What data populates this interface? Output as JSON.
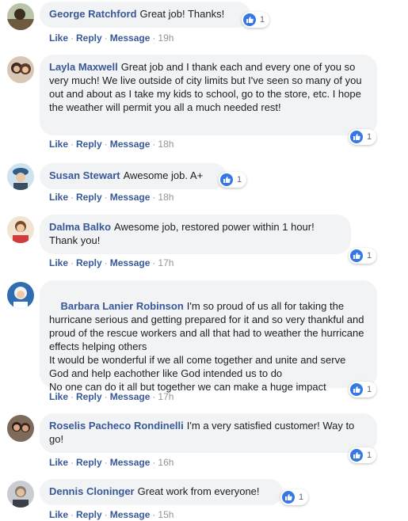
{
  "comments": [
    {
      "author": "George Ratchford",
      "text": "Great job! Thanks!",
      "reactions": "1",
      "actions": {
        "like": "Like",
        "reply": "Reply",
        "message": "Message",
        "time": "19h"
      }
    },
    {
      "author": "Layla Maxwell",
      "text": "Great job and I thank each and every one of you so very much! We live outside of city limits but I've seen so many of you out and about as I take my kids to school, go to the store, etc. I hope the weather will permit you all a much needed rest!",
      "reactions": "1",
      "actions": {
        "like": "Like",
        "reply": "Reply",
        "message": "Message",
        "time": "18h"
      }
    },
    {
      "author": "Susan Stewart",
      "text": "Awesome job. A+",
      "reactions": "1",
      "actions": {
        "like": "Like",
        "reply": "Reply",
        "message": "Message",
        "time": "18h"
      }
    },
    {
      "author": "Dalma Balko",
      "text": "Awesome job, restored power within 1 hour! Thank you!",
      "reactions": "1",
      "actions": {
        "like": "Like",
        "reply": "Reply",
        "message": "Message",
        "time": "17h"
      }
    },
    {
      "author": "Barbara Lanier Robinson",
      "text": "I'm so proud of us all for taking the hurricane serious and getting prepared for it and so very thankful and proud of the rescue workers and all that had to weather the hurricane effects helping others\nIt would be wonderful if we all come together and unite and serve God and help eachother like God intended us to do\nNo one can do it all but together we can make a huge impact",
      "reactions": "1",
      "actions": {
        "like": "Like",
        "reply": "Reply",
        "message": "Message",
        "time": "17h"
      }
    },
    {
      "author": "Roselis Pacheco Rondinelli",
      "text": "I'm a very satisfied customer! Way to go!",
      "reactions": "1",
      "actions": {
        "like": "Like",
        "reply": "Reply",
        "message": "Message",
        "time": "16h"
      }
    },
    {
      "author": "Dennis Cloninger",
      "text": "Great work from everyone!",
      "reactions": "1",
      "actions": {
        "like": "Like",
        "reply": "Reply",
        "message": "Message",
        "time": "15h"
      }
    }
  ],
  "colors": {
    "bubble": "#f2f3f5",
    "author": "#385898",
    "like_badge": "#3578e5",
    "meta": "#90949c"
  },
  "icons": {
    "reaction": "thumbs-up-icon"
  }
}
